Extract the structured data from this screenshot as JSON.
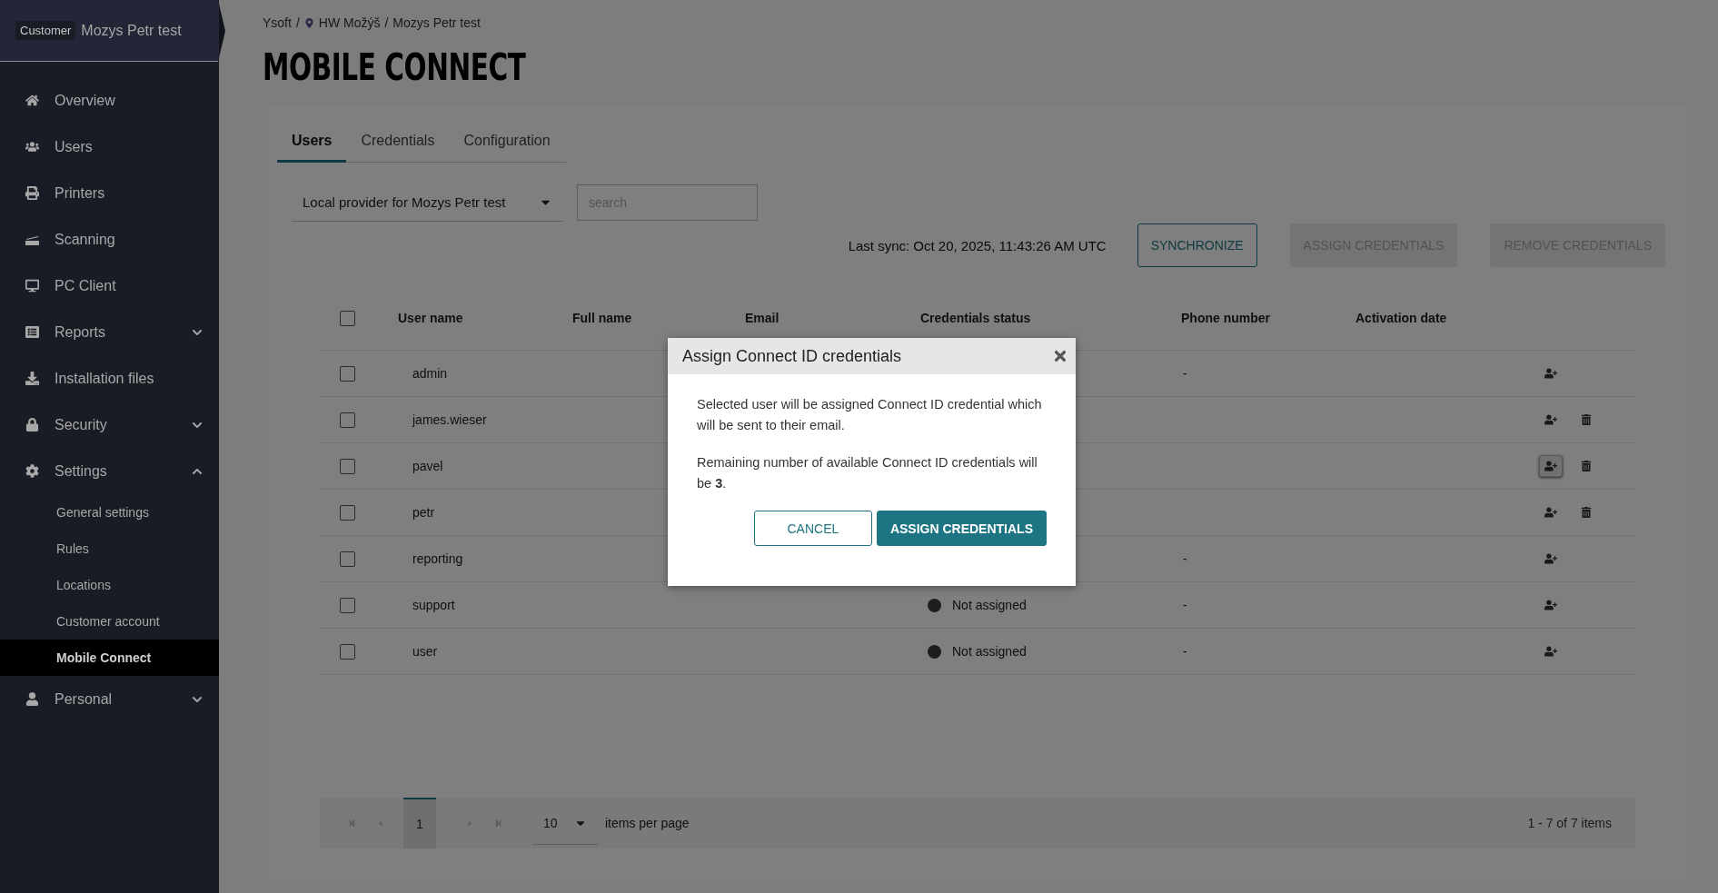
{
  "sidebar": {
    "customer_badge": "Customer",
    "customer_name": "Mozys Petr test",
    "items": [
      {
        "label": "Overview",
        "kind": "link",
        "selected": false
      },
      {
        "label": "Users",
        "kind": "link",
        "selected": false
      },
      {
        "label": "Printers",
        "kind": "link",
        "selected": false
      },
      {
        "label": "Scanning",
        "kind": "link",
        "selected": false
      },
      {
        "label": "PC Client",
        "kind": "link",
        "selected": false
      },
      {
        "label": "Reports",
        "kind": "group",
        "selected": false,
        "expanded": false
      },
      {
        "label": "Installation files",
        "kind": "link",
        "selected": false
      },
      {
        "label": "Security",
        "kind": "group",
        "selected": false,
        "expanded": false
      },
      {
        "label": "Settings",
        "kind": "group",
        "selected": false,
        "expanded": true,
        "children": [
          {
            "label": "General settings",
            "selected": false
          },
          {
            "label": "Rules",
            "selected": false
          },
          {
            "label": "Locations",
            "selected": false
          },
          {
            "label": "Customer account",
            "selected": false
          },
          {
            "label": "Mobile Connect",
            "selected": true
          }
        ]
      },
      {
        "label": "Personal",
        "kind": "group",
        "selected": false,
        "expanded": false
      }
    ]
  },
  "breadcrumb": {
    "separator": "/",
    "items": [
      {
        "label": "Ysoft",
        "kind": "plain"
      },
      {
        "label": "HW Možýš",
        "kind": "location"
      },
      {
        "label": "Mozys Petr test",
        "kind": "plain"
      }
    ]
  },
  "page_title": "MOBILE CONNECT",
  "tabs": [
    {
      "label": "Users",
      "selected": true
    },
    {
      "label": "Credentials",
      "selected": false
    },
    {
      "label": "Configuration",
      "selected": false
    }
  ],
  "toolbar": {
    "provider": "Local provider for Mozys Petr test",
    "search_placeholder": "search",
    "last_sync": "Last sync: Oct 20, 2025, 11:43:26 AM UTC",
    "buttons": [
      {
        "label": "SYNCHRONIZE",
        "disabled": false
      },
      {
        "label": "ASSIGN CREDENTIALS",
        "disabled": true
      },
      {
        "label": "REMOVE CREDENTIALS",
        "disabled": true
      }
    ]
  },
  "table": {
    "select_all_checked": false,
    "columns": [
      "User name",
      "Full name",
      "Email",
      "Credentials status",
      "Phone number",
      "Activation date"
    ],
    "rows": [
      {
        "user_name": "admin",
        "checked": false,
        "phone": "-",
        "removable": false,
        "highlighted": false
      },
      {
        "user_name": "james.wieser",
        "checked": false,
        "removable": true,
        "highlighted": false
      },
      {
        "user_name": "pavel",
        "checked": false,
        "removable": true,
        "highlighted": true
      },
      {
        "user_name": "petr",
        "checked": false,
        "removable": true,
        "highlighted": false
      },
      {
        "user_name": "reporting",
        "checked": false,
        "phone": "-",
        "removable": false,
        "highlighted": false
      },
      {
        "user_name": "support",
        "checked": false,
        "status": "Not assigned",
        "phone": "-",
        "removable": false,
        "highlighted": false
      },
      {
        "user_name": "user",
        "checked": false,
        "status": "Not assigned",
        "phone": "-",
        "removable": false,
        "highlighted": false
      }
    ]
  },
  "pagination": {
    "nav_disabled": true,
    "page": "1",
    "page_size": "10",
    "page_size_label": "items per page",
    "summary": "1 - 7 of 7 items"
  },
  "modal": {
    "title": "Assign Connect ID credentials",
    "paragraphs": [
      "Selected user will be assigned Connect ID credential which will be sent to their email.",
      "Remaining number of available Connect ID credentials will be **3**."
    ],
    "buttons": [
      {
        "label": "CANCEL",
        "kind": "secondary"
      },
      {
        "label": "ASSIGN CREDENTIALS",
        "kind": "primary"
      }
    ]
  }
}
